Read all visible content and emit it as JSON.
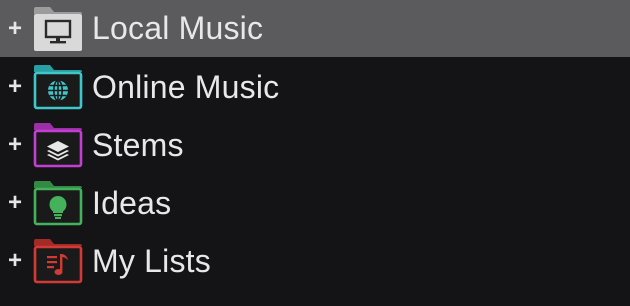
{
  "browser": {
    "items": [
      {
        "label": "Local Music",
        "icon": "monitor-icon",
        "color": "#d9d9d9",
        "expander": "+",
        "selected": true
      },
      {
        "label": "Online Music",
        "icon": "globe-icon",
        "color": "#3ec6c9",
        "expander": "+",
        "selected": false
      },
      {
        "label": "Stems",
        "icon": "layers-icon",
        "color": "#c23fd1",
        "expander": "+",
        "selected": false
      },
      {
        "label": "Ideas",
        "icon": "lightbulb-icon",
        "color": "#43b25a",
        "expander": "+",
        "selected": false
      },
      {
        "label": "My Lists",
        "icon": "playlist-icon",
        "color": "#d23b35",
        "expander": "+",
        "selected": false
      }
    ]
  }
}
